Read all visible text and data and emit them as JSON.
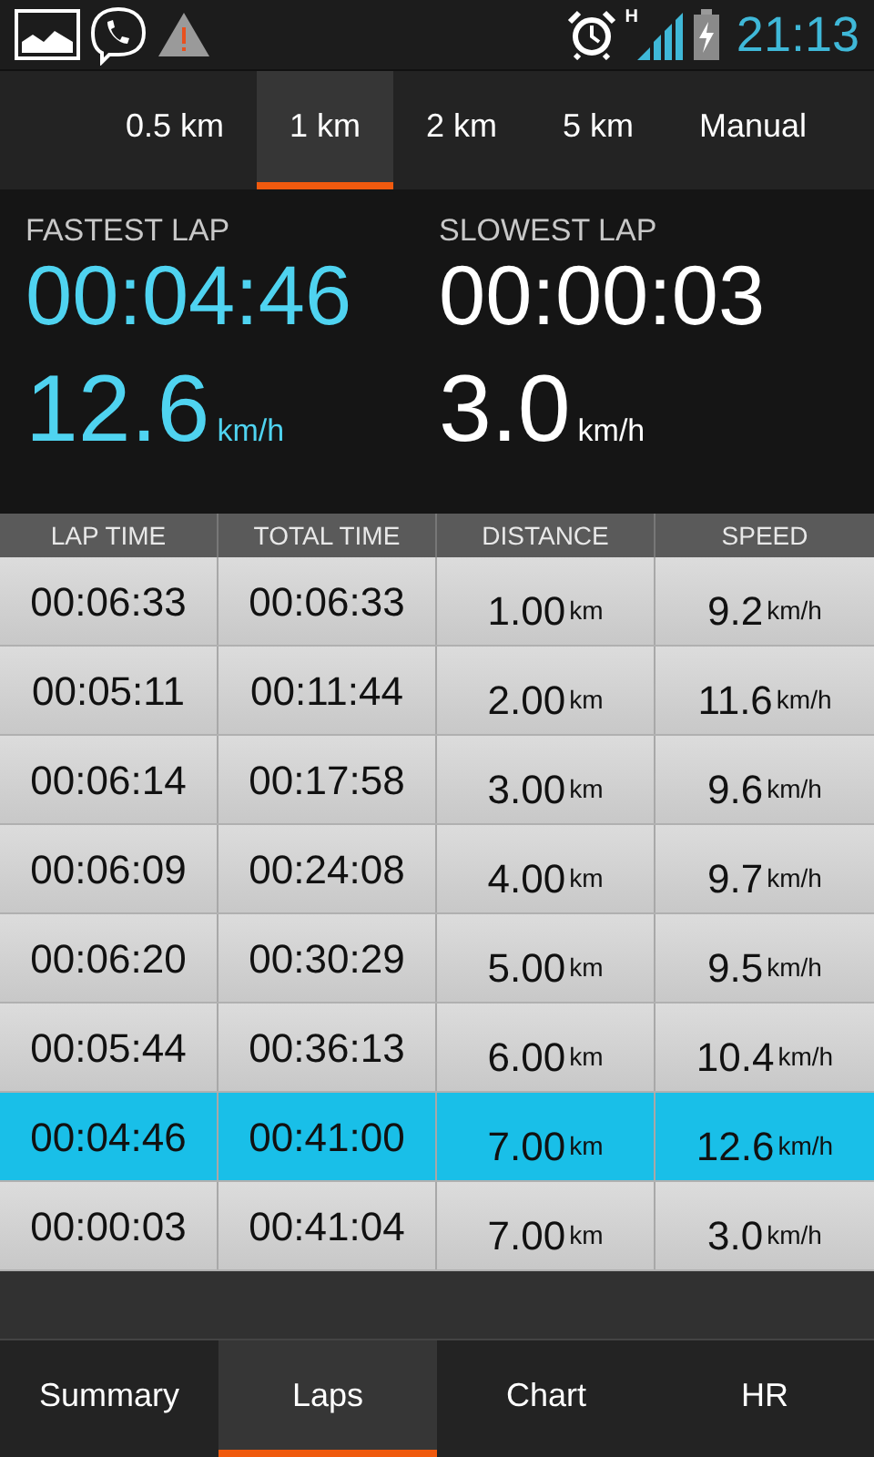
{
  "status_bar": {
    "network_type": "H",
    "time": "21:13"
  },
  "interval_tabs": [
    {
      "label": "0.5 km",
      "selected": false
    },
    {
      "label": "1 km",
      "selected": true
    },
    {
      "label": "2 km",
      "selected": false
    },
    {
      "label": "5 km",
      "selected": false
    },
    {
      "label": "Manual",
      "selected": false
    }
  ],
  "stats": [
    {
      "kind": "fastest",
      "label": "FASTEST LAP",
      "time": "00:04:46",
      "speed": "12.6",
      "unit": "km/h"
    },
    {
      "kind": "slowest",
      "label": "SLOWEST LAP",
      "time": "00:00:03",
      "speed": "3.0",
      "unit": "km/h"
    }
  ],
  "table": {
    "columns": [
      "LAP TIME",
      "TOTAL TIME",
      "DISTANCE",
      "SPEED"
    ],
    "rows": [
      {
        "lap_time": "00:06:33",
        "total_time": "00:06:33",
        "distance": "1.00",
        "distance_unit": "km",
        "speed": "9.2",
        "speed_unit": "km/h",
        "selected": false
      },
      {
        "lap_time": "00:05:11",
        "total_time": "00:11:44",
        "distance": "2.00",
        "distance_unit": "km",
        "speed": "11.6",
        "speed_unit": "km/h",
        "selected": false
      },
      {
        "lap_time": "00:06:14",
        "total_time": "00:17:58",
        "distance": "3.00",
        "distance_unit": "km",
        "speed": "9.6",
        "speed_unit": "km/h",
        "selected": false
      },
      {
        "lap_time": "00:06:09",
        "total_time": "00:24:08",
        "distance": "4.00",
        "distance_unit": "km",
        "speed": "9.7",
        "speed_unit": "km/h",
        "selected": false
      },
      {
        "lap_time": "00:06:20",
        "total_time": "00:30:29",
        "distance": "5.00",
        "distance_unit": "km",
        "speed": "9.5",
        "speed_unit": "km/h",
        "selected": false
      },
      {
        "lap_time": "00:05:44",
        "total_time": "00:36:13",
        "distance": "6.00",
        "distance_unit": "km",
        "speed": "10.4",
        "speed_unit": "km/h",
        "selected": false
      },
      {
        "lap_time": "00:04:46",
        "total_time": "00:41:00",
        "distance": "7.00",
        "distance_unit": "km",
        "speed": "12.6",
        "speed_unit": "km/h",
        "selected": true
      },
      {
        "lap_time": "00:00:03",
        "total_time": "00:41:04",
        "distance": "7.00",
        "distance_unit": "km",
        "speed": "3.0",
        "speed_unit": "km/h",
        "selected": false
      }
    ]
  },
  "bottom_tabs": [
    {
      "label": "Summary",
      "selected": false
    },
    {
      "label": "Laps",
      "selected": true
    },
    {
      "label": "Chart",
      "selected": false
    },
    {
      "label": "HR",
      "selected": false
    }
  ]
}
